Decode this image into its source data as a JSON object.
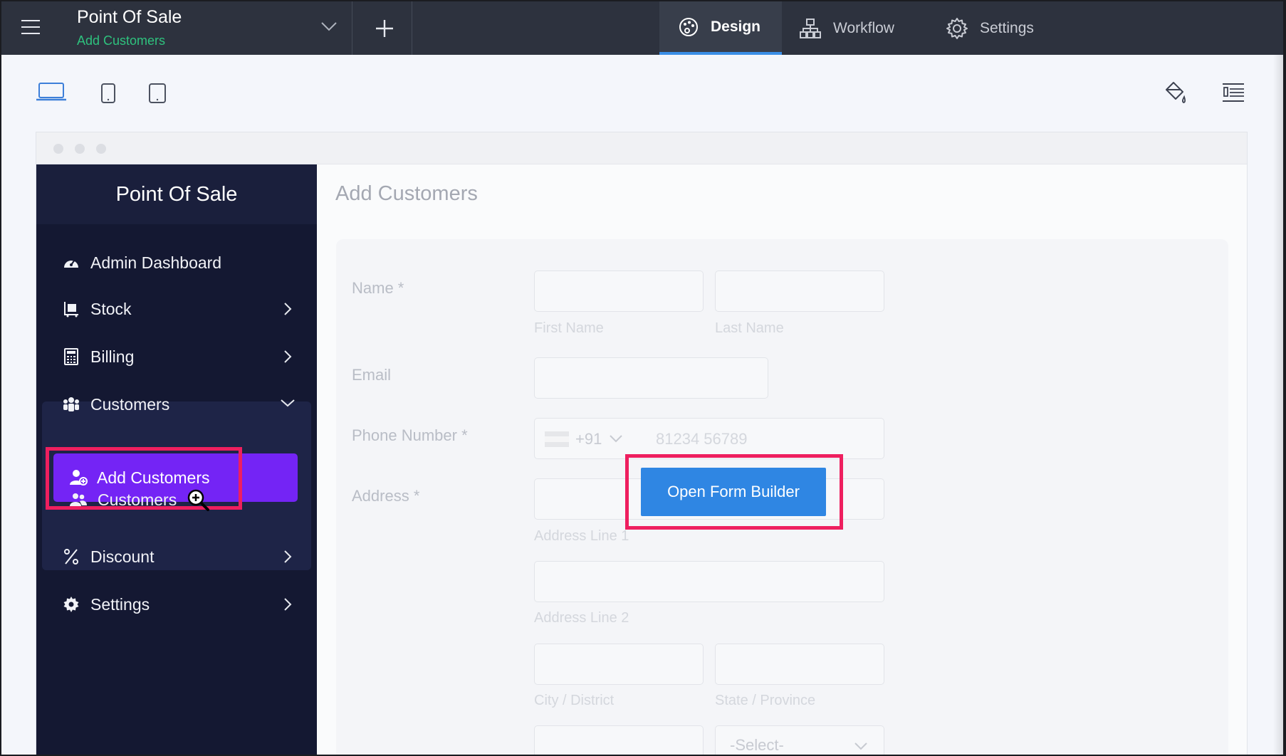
{
  "topbar": {
    "app_title": "Point Of Sale",
    "app_subtitle": "Add Customers",
    "tabs": [
      {
        "label": "Design",
        "icon": "palette-icon",
        "active": true
      },
      {
        "label": "Workflow",
        "icon": "workflow-icon",
        "active": false
      },
      {
        "label": "Settings",
        "icon": "gear-icon",
        "active": false
      }
    ]
  },
  "devices": [
    "laptop-icon",
    "mobile-icon",
    "tablet-icon"
  ],
  "toolbar_right": [
    "paint-bucket-icon",
    "layout-list-icon"
  ],
  "sidebar": {
    "brand": "Point Of Sale",
    "items": [
      {
        "label": "Admin Dashboard",
        "icon": "dashboard-icon"
      },
      {
        "label": "Stock",
        "icon": "cart-icon"
      },
      {
        "label": "Billing",
        "icon": "calculator-icon"
      },
      {
        "label": "Customers",
        "icon": "group-icon",
        "expanded": true,
        "children": [
          {
            "label": "Add Customers",
            "icon": "add-user-icon",
            "active": true
          },
          {
            "label": "Customers",
            "icon": "users-icon"
          }
        ]
      },
      {
        "label": "Discount",
        "icon": "percent-icon"
      },
      {
        "label": "Settings",
        "icon": "gear-icon"
      }
    ]
  },
  "form": {
    "title": "Add Customers",
    "name_label": "Name *",
    "first_name_hint": "First Name",
    "last_name_hint": "Last Name",
    "email_label": "Email",
    "phone_label": "Phone Number *",
    "phone_code": "+91",
    "phone_placeholder": "81234 56789",
    "address_label": "Address *",
    "address_line1_hint": "Address Line 1",
    "address_line2_hint": "Address Line 2",
    "city_hint": "City / District",
    "state_hint": "State / Province",
    "country_select": "-Select-"
  },
  "overlay_button": "Open Form Builder",
  "colors": {
    "topbar": "#2d323e",
    "accent_green": "#2ec27e",
    "sidebar": "#141832",
    "active_item": "#7424f5",
    "highlight": "#ee1f5f",
    "button_blue": "#2f86e3"
  }
}
